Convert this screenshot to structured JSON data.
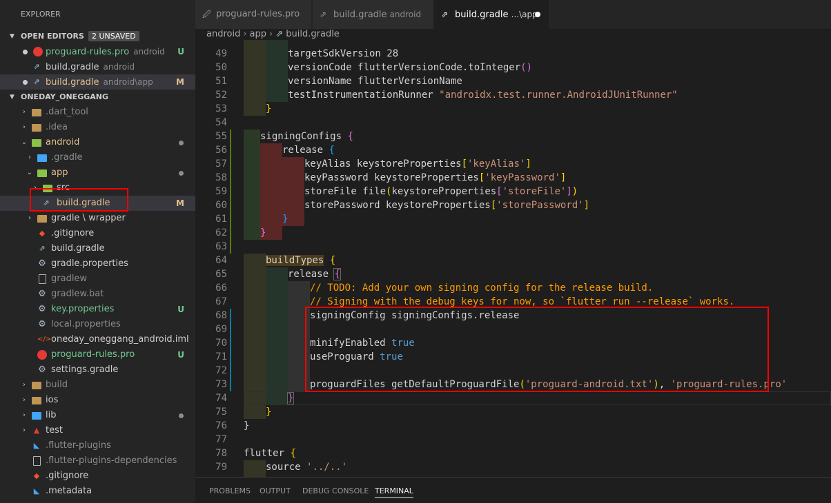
{
  "sidebar": {
    "title": "EXPLORER",
    "open_editors": {
      "label": "OPEN EDITORS",
      "badge": "2 UNSAVED",
      "items": [
        {
          "name": "proguard-rules.pro",
          "desc": "android",
          "status": "U"
        },
        {
          "name": "build.gradle",
          "desc": "android",
          "status": ""
        },
        {
          "name": "build.gradle",
          "desc": "android\\app",
          "status": "M"
        }
      ]
    },
    "project": {
      "label": "ONEDAY_ONEGGANG",
      "items": [
        {
          "name": ".dart_tool"
        },
        {
          "name": ".idea"
        },
        {
          "name": "android"
        },
        {
          "name": ".gradle"
        },
        {
          "name": "app"
        },
        {
          "name": "src"
        },
        {
          "name": "build.gradle",
          "status": "M"
        },
        {
          "name": "gradle \\ wrapper"
        },
        {
          "name": ".gitignore"
        },
        {
          "name": "build.gradle"
        },
        {
          "name": "gradle.properties"
        },
        {
          "name": "gradlew"
        },
        {
          "name": "gradlew.bat"
        },
        {
          "name": "key.properties",
          "status": "U"
        },
        {
          "name": "local.properties"
        },
        {
          "name": "oneday_oneggang_android.iml"
        },
        {
          "name": "proguard-rules.pro",
          "status": "U"
        },
        {
          "name": "settings.gradle"
        },
        {
          "name": "build"
        },
        {
          "name": "ios"
        },
        {
          "name": "lib"
        },
        {
          "name": "test"
        },
        {
          "name": ".flutter-plugins"
        },
        {
          "name": ".flutter-plugins-dependencies"
        },
        {
          "name": ".gitignore"
        },
        {
          "name": ".metadata"
        }
      ]
    }
  },
  "tabs": [
    {
      "name": "proguard-rules.pro",
      "desc": ""
    },
    {
      "name": "build.gradle",
      "desc": "android"
    },
    {
      "name": "build.gradle",
      "desc": "...\\app"
    }
  ],
  "breadcrumb": [
    "android",
    "app",
    "build.gradle"
  ],
  "line_numbers": [
    "49",
    "50",
    "51",
    "52",
    "53",
    "54",
    "55",
    "56",
    "57",
    "58",
    "59",
    "60",
    "61",
    "62",
    "63",
    "64",
    "65",
    "66",
    "67",
    "68",
    "69",
    "70",
    "71",
    "72",
    "73",
    "74",
    "75",
    "76",
    "77",
    "78",
    "79"
  ],
  "code": {
    "l49": [
      "targetSdkVersion 28"
    ],
    "l50": [
      "versionCode flutterVersionCode.toInteger",
      "()"
    ],
    "l51": [
      "versionName flutterVersionName"
    ],
    "l52": [
      "testInstrumentationRunner ",
      "\"androidx.test.runner.AndroidJUnitRunner\""
    ],
    "l53": [
      "}"
    ],
    "l55": [
      "signingConfigs ",
      "{"
    ],
    "l56": [
      "release ",
      "{"
    ],
    "l57": [
      "keyAlias keystoreProperties",
      "[",
      "'keyAlias'",
      "]"
    ],
    "l58": [
      "keyPassword keystoreProperties",
      "[",
      "'keyPassword'",
      "]"
    ],
    "l59": [
      "storeFile file",
      "(",
      "keystoreProperties",
      "[",
      "'storeFile'",
      "]",
      ")"
    ],
    "l60": [
      "storePassword keystoreProperties",
      "[",
      "'storePassword'",
      "]"
    ],
    "l61": [
      "}"
    ],
    "l62": [
      "}"
    ],
    "l64": [
      "buildTypes",
      " ",
      "{"
    ],
    "l65": [
      "release ",
      "{"
    ],
    "l66": [
      "// TODO: Add your own signing config for the release build."
    ],
    "l67": [
      "// Signing with the debug keys for now, so `flutter run --release` works."
    ],
    "l68": [
      "signingConfig signingConfigs.release"
    ],
    "l70": [
      "minifyEnabled ",
      "true"
    ],
    "l71": [
      "useProguard ",
      "true"
    ],
    "l73": [
      "proguardFiles getDefaultProguardFile",
      "(",
      "'proguard-android.txt'",
      ")",
      ", ",
      "'proguard-rules.pro'"
    ],
    "l74": [
      "}"
    ],
    "l75": [
      "}"
    ],
    "l76": [
      "}"
    ],
    "l78": [
      "flutter ",
      "{"
    ],
    "l79": [
      "source ",
      "'../..'"
    ]
  },
  "panel": [
    "PROBLEMS",
    "OUTPUT",
    "DEBUG CONSOLE",
    "TERMINAL"
  ],
  "colors": {
    "accent_red": "#ff0000",
    "untracked": "#73c991",
    "modified": "#e2c08d"
  }
}
